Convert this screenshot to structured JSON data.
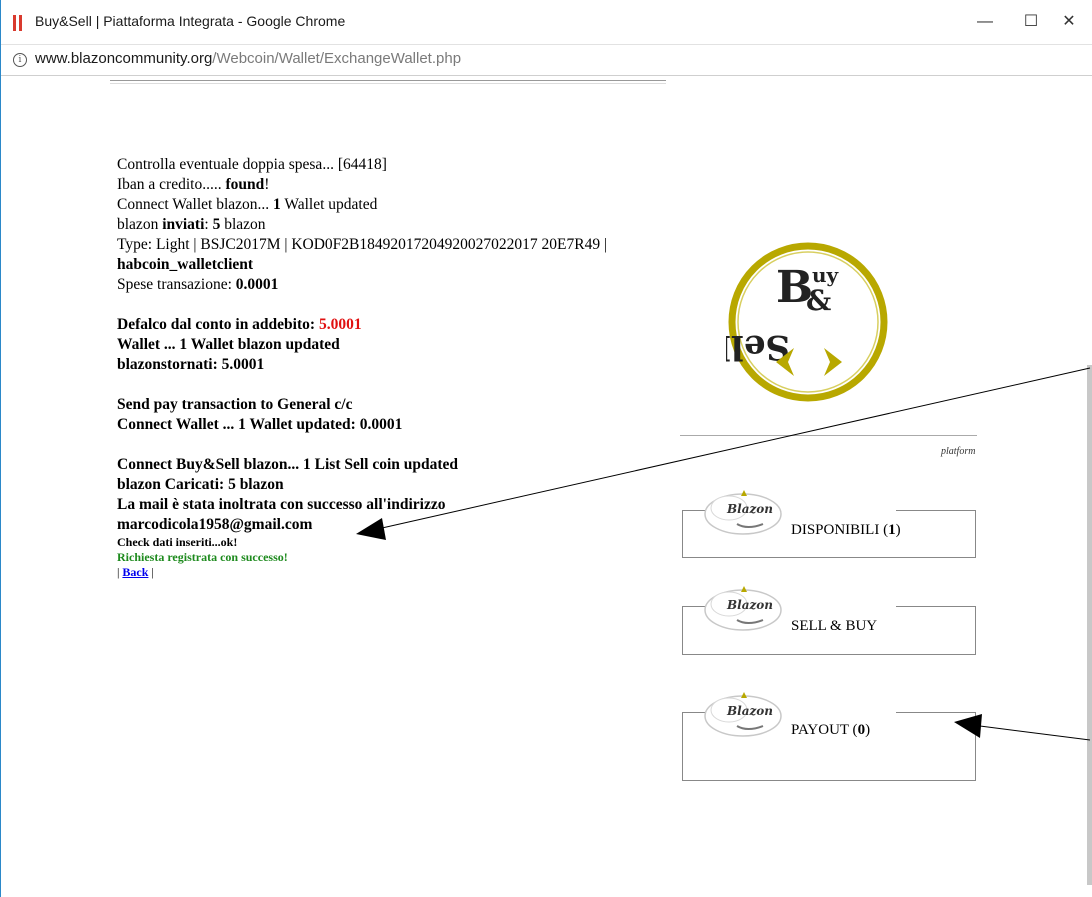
{
  "window": {
    "title": "Buy&Sell | Piattaforma Integrata - Google Chrome",
    "minimize": "—",
    "maximize": "☐",
    "close": "✕"
  },
  "address": {
    "domain": "www.blazoncommunity.org",
    "path": "/Webcoin/Wallet/ExchangeWallet.php"
  },
  "log": {
    "l1": "Controlla eventuale doppia spesa... [64418]",
    "l2_a": "Iban a credito..... ",
    "l2_b": "found",
    "l2_c": "!",
    "l3_a": "Connect Wallet blazon... ",
    "l3_b": "1",
    "l3_c": " Wallet updated",
    "l4_a": "blazon ",
    "l4_b": "inviati",
    "l4_c": ": ",
    "l4_d": "5",
    "l4_e": " blazon",
    "l5": "Type: Light | BSJC2017M | KOD0F2B18492017204920027022017 20E7R49 |",
    "l6": "habcoin_walletclient",
    "l7_a": "Spese transazione: ",
    "l7_b": "0.0001",
    "l8_a": "Defalco dal conto in addebito: ",
    "l8_b": "5.0001",
    "l9": "Wallet ... 1 Wallet blazon updated",
    "l10": "blazonstornati: 5.0001",
    "l11": "Send pay transaction to General c/c",
    "l12": "Connect Wallet ... 1 Wallet updated: 0.0001",
    "l13": "Connect Buy&Sell blazon... 1 List Sell coin updated",
    "l14": "blazon Caricati: 5 blazon",
    "l15": "La mail è stata inoltrata con successo all'indirizzo",
    "l16": "marcodicola1958@gmail.com",
    "l17": "Check dati inseriti...ok!",
    "l18": "Richiesta registrata con successo!",
    "back_pre": "| ",
    "back": "Back",
    "back_post": " |"
  },
  "logo": {
    "b": "B",
    "uy": "uy",
    "amp": "&",
    "ell": "Sell"
  },
  "platform_label": "platform",
  "menu": [
    {
      "brand": "Blazon",
      "label": "DISPONIBILI (",
      "count": "1",
      "close": ")"
    },
    {
      "brand": "Blazon",
      "label": "SELL & BUY",
      "count": "",
      "close": ""
    },
    {
      "brand": "Blazon",
      "label": "PAYOUT (",
      "count": "0",
      "close": ")"
    }
  ],
  "colors": {
    "accent": "#d93a2e",
    "logo_gold": "#b8a800",
    "error_red": "#e01010",
    "success_green": "#1d8a1d",
    "link": "#0000ee"
  }
}
